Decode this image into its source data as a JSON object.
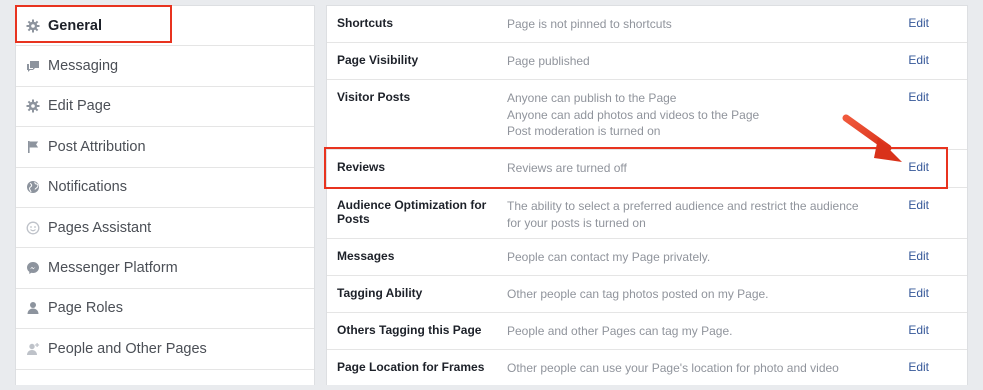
{
  "sidebar": {
    "items": [
      {
        "label": "General",
        "icon": "gear-icon"
      },
      {
        "label": "Messaging",
        "icon": "speech-bubbles-icon"
      },
      {
        "label": "Edit Page",
        "icon": "gear-icon"
      },
      {
        "label": "Post Attribution",
        "icon": "flag-icon"
      },
      {
        "label": "Notifications",
        "icon": "globe-icon"
      },
      {
        "label": "Pages Assistant",
        "icon": "smiley-icon"
      },
      {
        "label": "Messenger Platform",
        "icon": "messenger-icon"
      },
      {
        "label": "Page Roles",
        "icon": "person-icon"
      },
      {
        "label": "People and Other Pages",
        "icon": "add-person-icon"
      }
    ]
  },
  "settings": {
    "edit_label": "Edit",
    "rows": [
      {
        "label": "Shortcuts",
        "value": [
          "Page is not pinned to shortcuts"
        ]
      },
      {
        "label": "Page Visibility",
        "value": [
          "Page published"
        ]
      },
      {
        "label": "Visitor Posts",
        "value": [
          "Anyone can publish to the Page",
          "Anyone can add photos and videos to the Page",
          "Post moderation is turned on"
        ]
      },
      {
        "label": "Reviews",
        "value": [
          "Reviews are turned off"
        ]
      },
      {
        "label": "Audience Optimization for Posts",
        "value": [
          "The ability to select a preferred audience and restrict the audience",
          "for your posts is turned on"
        ]
      },
      {
        "label": "Messages",
        "value": [
          "People can contact my Page privately."
        ]
      },
      {
        "label": "Tagging Ability",
        "value": [
          "Other people can tag photos posted on my Page."
        ]
      },
      {
        "label": "Others Tagging this Page",
        "value": [
          "People and other Pages can tag my Page."
        ]
      },
      {
        "label": "Page Location for Frames",
        "value": [
          "Other people can use your Page's location for photo and video"
        ]
      }
    ]
  },
  "colors": {
    "annotation": "#e8331f",
    "link": "#365899",
    "muted_text": "#90949c",
    "background": "#e9ebee"
  }
}
